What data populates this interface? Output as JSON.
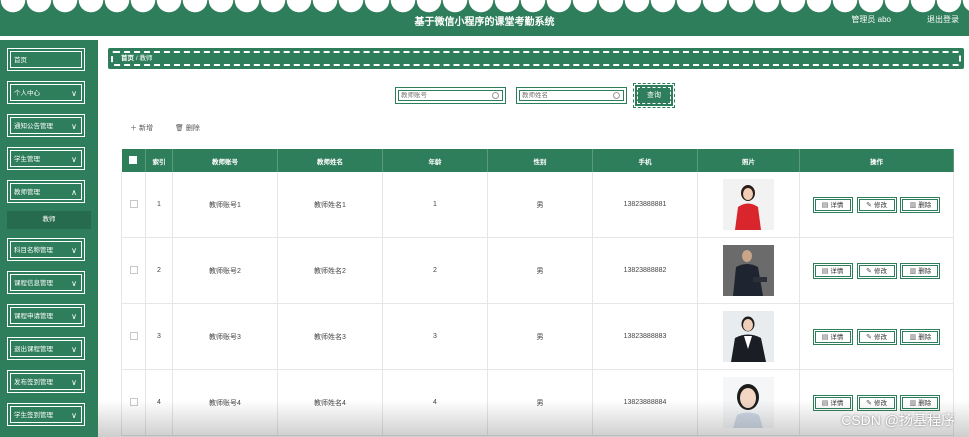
{
  "header": {
    "title": "基于微信小程序的课堂考勤系统",
    "admin": "管理员 abo",
    "logout": "退出登录"
  },
  "sidebar": {
    "items": [
      {
        "label": "首页",
        "chevron": false
      },
      {
        "label": "个人中心",
        "chevron": true
      },
      {
        "label": "通知公告管理",
        "chevron": true
      },
      {
        "label": "学生管理",
        "chevron": true
      },
      {
        "label": "教师管理",
        "chevron": true
      },
      {
        "label": "科目名称管理",
        "chevron": true
      },
      {
        "label": "课程信息管理",
        "chevron": true
      },
      {
        "label": "课程申请管理",
        "chevron": true
      },
      {
        "label": "退出课程管理",
        "chevron": true
      },
      {
        "label": "发布签到管理",
        "chevron": true
      },
      {
        "label": "学生签到管理",
        "chevron": true
      }
    ],
    "sub_item": "教师"
  },
  "breadcrumb": {
    "home": "首页",
    "sep": "/",
    "current": "教师"
  },
  "search": {
    "account_placeholder": "教师账号",
    "name_placeholder": "教师姓名",
    "button": "查询"
  },
  "actions": {
    "add": "新增",
    "delete": "删除"
  },
  "table": {
    "headers": [
      "索引",
      "教师账号",
      "教师姓名",
      "年龄",
      "性别",
      "手机",
      "照片",
      "操作"
    ],
    "rows": [
      {
        "index": "1",
        "account": "教师账号1",
        "name": "教师姓名1",
        "age": "1",
        "gender": "男",
        "phone": "13823888881",
        "photo": "photo-woman-red"
      },
      {
        "index": "2",
        "account": "教师账号2",
        "name": "教师姓名2",
        "age": "2",
        "gender": "男",
        "phone": "13823888882",
        "photo": "photo-man-suit"
      },
      {
        "index": "3",
        "account": "教师账号3",
        "name": "教师姓名3",
        "age": "3",
        "gender": "男",
        "phone": "13823888883",
        "photo": "photo-woman-blazer"
      },
      {
        "index": "4",
        "account": "教师账号4",
        "name": "教师姓名4",
        "age": "4",
        "gender": "男",
        "phone": "13823888884",
        "photo": "photo-woman-portrait"
      }
    ],
    "ops": {
      "detail": "详情",
      "edit": "修改",
      "delete": "删除"
    }
  },
  "watermark": "CSDN @扬基程序",
  "colors": {
    "primary": "#2e7d5b",
    "background": "#ffffff"
  }
}
